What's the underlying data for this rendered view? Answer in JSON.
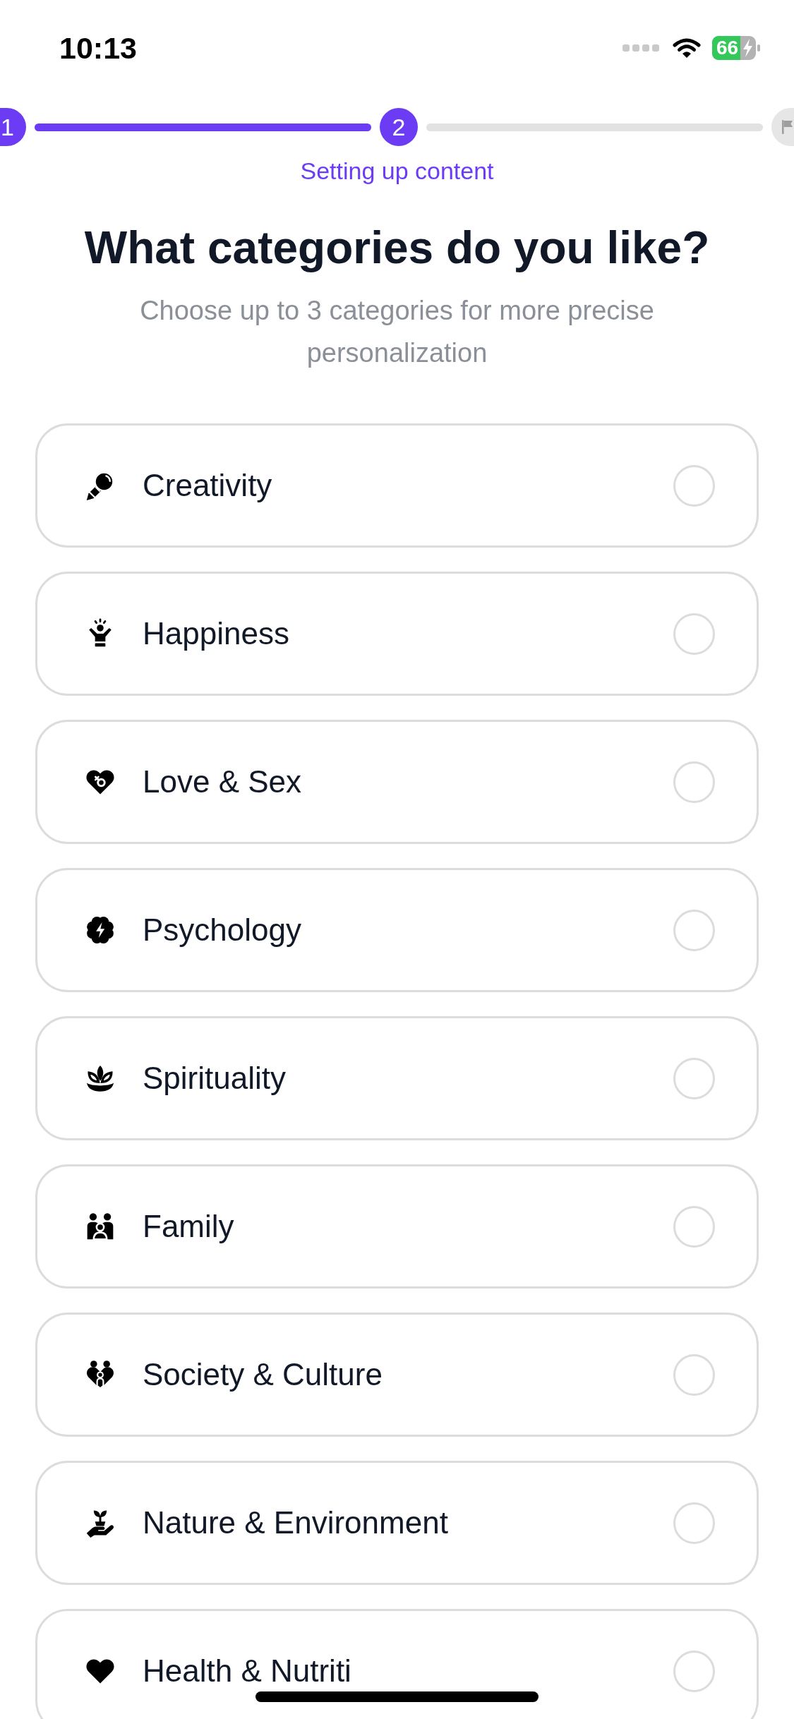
{
  "status_bar": {
    "time": "10:13",
    "battery": "66"
  },
  "stepper": {
    "steps": [
      {
        "kind": "number",
        "label": "1",
        "active": true
      },
      {
        "kind": "number",
        "label": "2",
        "active": true
      },
      {
        "kind": "flag",
        "active": false
      }
    ],
    "caption": "Setting up content"
  },
  "title": "What categories do you like?",
  "subtitle": "Choose up to 3 categories for more precise personalization",
  "categories": [
    {
      "label": "Creativity",
      "selected": false
    },
    {
      "label": "Happiness",
      "selected": false
    },
    {
      "label": "Love & Sex",
      "selected": false
    },
    {
      "label": "Psychology",
      "selected": false
    },
    {
      "label": "Spirituality",
      "selected": false
    },
    {
      "label": "Family",
      "selected": false
    },
    {
      "label": "Society & Culture",
      "selected": false
    },
    {
      "label": "Nature & Environment",
      "selected": false
    },
    {
      "label": "Health & Nutriti",
      "selected": false
    }
  ]
}
